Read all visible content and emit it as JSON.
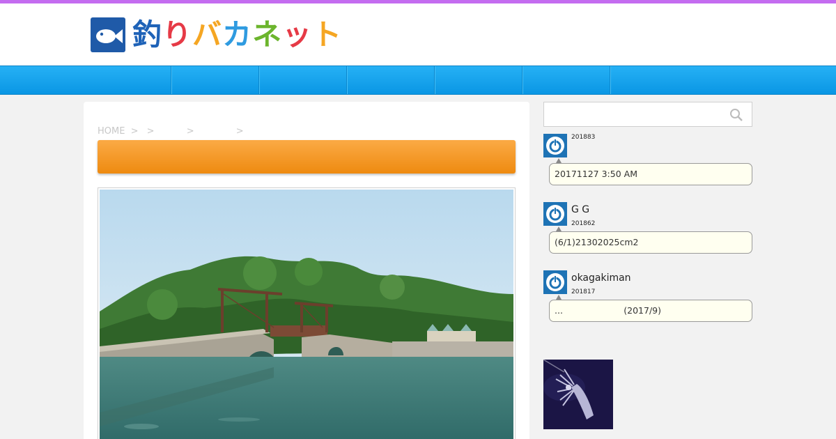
{
  "colors": {
    "top_stripe": "#c46cf0",
    "nav_blue": "#0a96e4",
    "title_orange": "#f29a25",
    "avatar_blue": "#1e73b5",
    "bubble_bg": "#fffff0"
  },
  "logo": {
    "icon": "fish-icon",
    "text_chars": [
      {
        "ch": "釣",
        "color": "#1f63b8"
      },
      {
        "ch": "り",
        "color": "#e63a46"
      },
      {
        "ch": "バ",
        "color": "#f5a623"
      },
      {
        "ch": "カ",
        "color": "#2f9be0"
      },
      {
        "ch": "ネ",
        "color": "#6cb52d"
      },
      {
        "ch": "ッ",
        "color": "#e63a46"
      },
      {
        "ch": "ト",
        "color": "#f5a623"
      }
    ]
  },
  "breadcrumb": {
    "home": "HOME",
    "sep": ">"
  },
  "search": {
    "placeholder": "",
    "icon": "search-icon"
  },
  "comments": [
    {
      "name": "",
      "date": "201883",
      "text": "20171127 3:50 AM",
      "text_right": ""
    },
    {
      "name": "G G",
      "date": "201862",
      "text": "(6/1)21302025cm2",
      "text_right": ""
    },
    {
      "name": "okagakiman",
      "date": "201817",
      "text": "...",
      "text_right": "(2017/9)"
    }
  ]
}
